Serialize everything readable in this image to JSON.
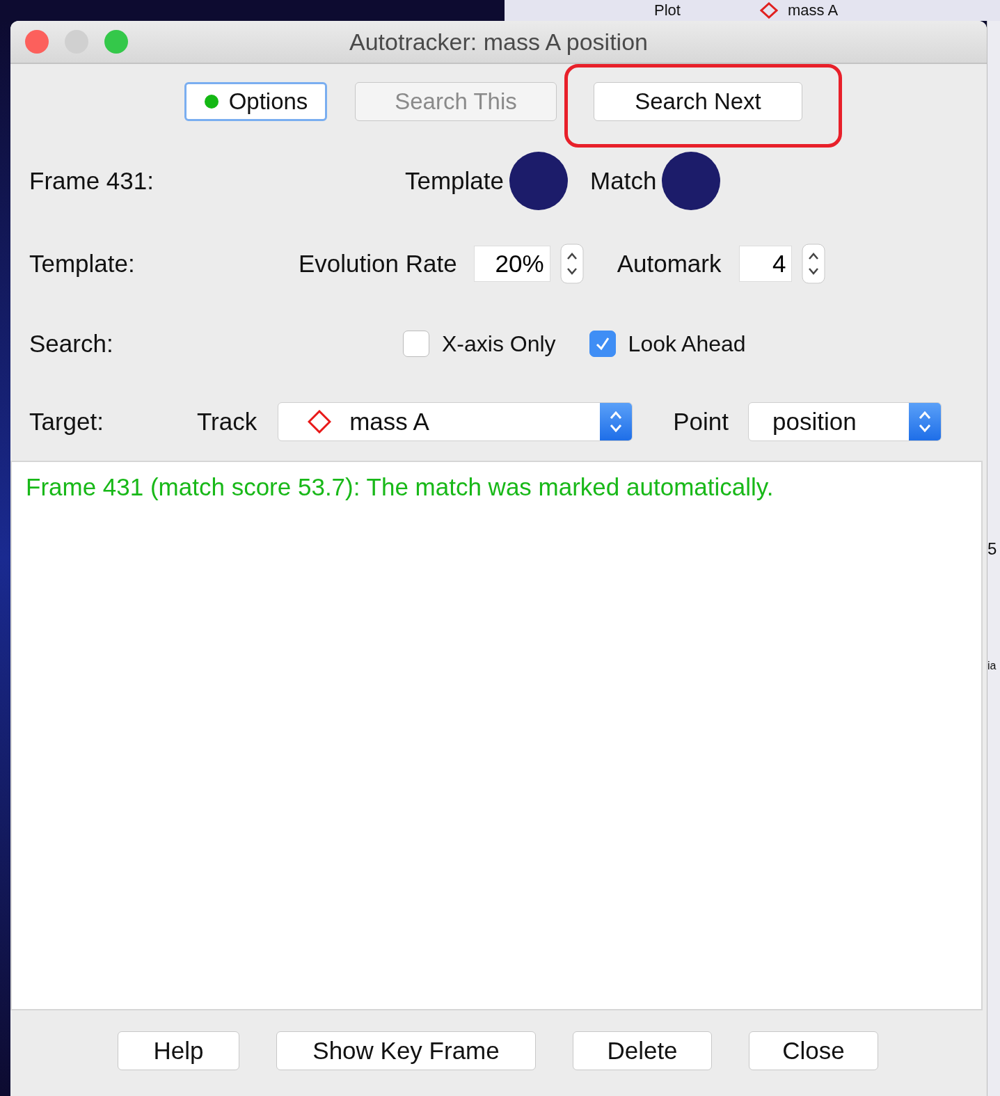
{
  "background_app": {
    "toolbar_items": [
      "Plot",
      "mass A"
    ],
    "side_fragments": [
      "5",
      "ia"
    ]
  },
  "window": {
    "title": "Autotracker: mass A position",
    "controls": [
      {
        "kind": "close",
        "disabled": false
      },
      {
        "kind": "minimize",
        "disabled": true
      },
      {
        "kind": "zoom",
        "disabled": false
      }
    ]
  },
  "toolbar_buttons": [
    {
      "label": "Options",
      "kind": "status",
      "focused": true,
      "disabled": false,
      "annotated": false
    },
    {
      "label": "Search This",
      "kind": "plain",
      "focused": false,
      "disabled": true,
      "annotated": false
    },
    {
      "label": "Search Next",
      "kind": "plain",
      "focused": false,
      "disabled": false,
      "annotated": true
    }
  ],
  "frame_row": {
    "label": "Frame 431:",
    "template_label": "Template",
    "match_label": "Match"
  },
  "template_row": {
    "label": "Template:",
    "fields": [
      {
        "label": "Evolution Rate",
        "value": "20%"
      },
      {
        "label": "Automark",
        "value": "4"
      }
    ]
  },
  "search_row": {
    "label": "Search:",
    "options": [
      {
        "label": "X-axis Only",
        "checked": false
      },
      {
        "label": "Look Ahead",
        "checked": true
      }
    ]
  },
  "target_row": {
    "label": "Target:",
    "selects": [
      {
        "label": "Track",
        "value": "mass A",
        "kind": "track"
      },
      {
        "label": "Point",
        "value": "position",
        "kind": "point"
      }
    ]
  },
  "log": {
    "messages": [
      "Frame 431 (match score 53.7): The match was marked automatically."
    ]
  },
  "footer_buttons": [
    "Help",
    "Show Key Frame",
    "Delete",
    "Close"
  ]
}
